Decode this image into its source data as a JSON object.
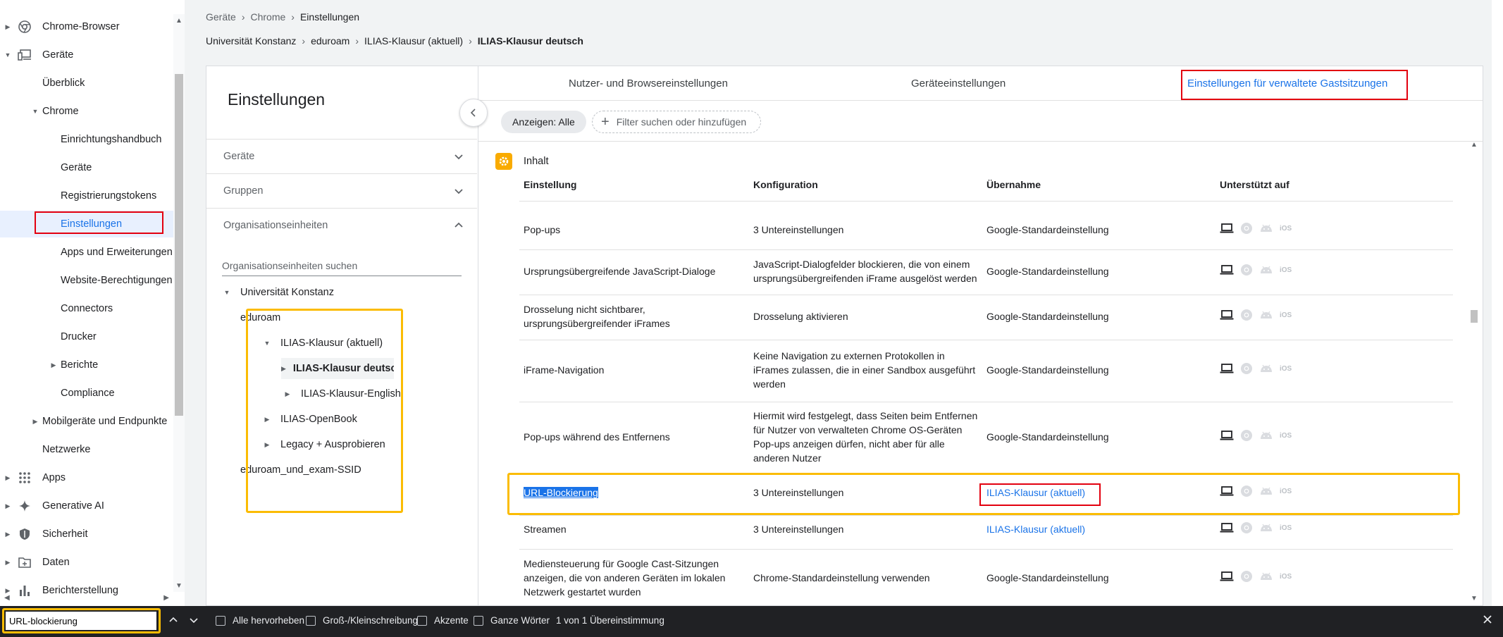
{
  "sidebar": {
    "chrome_browser": "Chrome-Browser",
    "devices": "Geräte",
    "overview": "Überblick",
    "chrome": "Chrome",
    "setup_guide": "Einrichtungshandbuch",
    "chrome_devices": "Geräte",
    "registration_tokens": "Registrierungstokens",
    "settings": "Einstellungen",
    "apps_extensions": "Apps und Erweiterungen",
    "website_permissions": "Website-Berechtigungen",
    "connectors": "Connectors",
    "printers": "Drucker",
    "reports": "Berichte",
    "compliance": "Compliance",
    "mobile": "Mobilgeräte und Endpunkte",
    "networks": "Netzwerke",
    "apps": "Apps",
    "gen_ai": "Generative AI",
    "security": "Sicherheit",
    "data": "Daten",
    "reporting": "Berichterstellung"
  },
  "breadcrumb1": {
    "a": "Geräte",
    "b": "Chrome",
    "c": "Einstellungen"
  },
  "breadcrumb2": {
    "a": "Universität Konstanz",
    "b": "eduroam",
    "c": "ILIAS-Klausur (aktuell)",
    "d": "ILIAS-Klausur deutsch"
  },
  "left_panel": {
    "title": "Einstellungen",
    "acc_devices": "Geräte",
    "acc_groups": "Gruppen",
    "acc_orgunits": "Organisationseinheiten",
    "search_placeholder": "Organisationseinheiten suchen",
    "tree": {
      "root": "Universität Konstanz",
      "eduroam": "eduroam",
      "ilias_current": "ILIAS-Klausur (aktuell)",
      "ilias_de": "ILIAS-Klausur deutsch",
      "ilias_en": "ILIAS-Klausur-English",
      "openbook": "ILIAS-OpenBook",
      "legacy": "Legacy + Ausprobieren",
      "exam_ssid": "eduroam_und_exam-SSID"
    }
  },
  "tabs": {
    "user_browser": "Nutzer- und Browsereinstellungen",
    "device": "Geräteeinstellungen",
    "guest": "Einstellungen für verwaltete Gastsitzungen"
  },
  "filter": {
    "chip": "Anzeigen: Alle",
    "add": "Filter suchen oder hinzufügen"
  },
  "section": "Inhalt",
  "table": {
    "headers": {
      "setting": "Einstellung",
      "config": "Konfiguration",
      "inheritance": "Übernahme",
      "supported": "Unterstützt auf"
    },
    "ios_label": "iOS",
    "rows": [
      {
        "setting": "Pop-ups",
        "config": [
          "3 Untereinstellungen"
        ],
        "inheritance": "Google-Standardeinstellung",
        "link": false
      },
      {
        "setting": "Ursprungsübergreifende JavaScript-Dialoge",
        "config": [
          "JavaScript-Dialogfelder blockieren, die von einem",
          "ursprungsübergreifenden iFrame ausgelöst werden"
        ],
        "inheritance": "Google-Standardeinstellung",
        "link": false
      },
      {
        "setting": "Drosselung nicht sichtbarer,\nursprungsübergreifender iFrames",
        "config": [
          "Drosselung aktivieren"
        ],
        "inheritance": "Google-Standardeinstellung",
        "link": false
      },
      {
        "setting": "iFrame-Navigation",
        "config": [
          "Keine Navigation zu externen Protokollen in",
          "iFrames zulassen, die in einer Sandbox ausgeführt",
          "werden"
        ],
        "inheritance": "Google-Standardeinstellung",
        "link": false
      },
      {
        "setting": "Pop-ups während des Entfernens",
        "config": [
          "Hiermit wird festgelegt, dass Seiten beim Entfernen",
          "für Nutzer von verwalteten Chrome OS-Geräten",
          "Pop-ups anzeigen dürfen, nicht aber für alle",
          "anderen Nutzer"
        ],
        "inheritance": "Google-Standardeinstellung",
        "link": false
      },
      {
        "setting": "URL-Blockierung",
        "config": [
          "3 Untereinstellungen"
        ],
        "inheritance": "ILIAS-Klausur (aktuell)",
        "link": true
      },
      {
        "setting": "Streamen",
        "config": [
          "3 Untereinstellungen"
        ],
        "inheritance": "ILIAS-Klausur (aktuell)",
        "link": true
      },
      {
        "setting": "Mediensteuerung für Google Cast-Sitzungen\nanzeigen, die von anderen Geräten im lokalen\nNetzwerk gestartet wurden",
        "config": [
          "Chrome-Standardeinstellung verwenden"
        ],
        "inheritance": "Google-Standardeinstellung",
        "link": false
      }
    ]
  },
  "findbar": {
    "query": "URL-blockierung",
    "highlight_all": "Alle hervorheben",
    "match_case": "Groß-/Kleinschreibung",
    "diacritics": "Akzente",
    "whole_words": "Ganze Wörter",
    "result": "1 von 1 Übereinstimmung"
  },
  "colors": {
    "accent": "#1a73e8",
    "annotation_red": "#e3000f",
    "annotation_yellow": "#fbbc04",
    "section_icon": "#f9ab00"
  }
}
